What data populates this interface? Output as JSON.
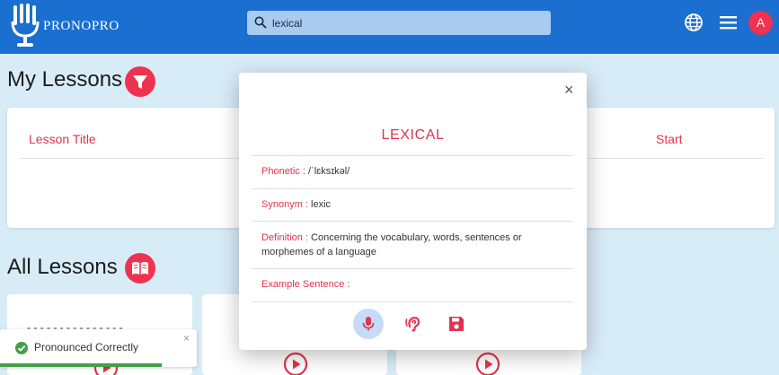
{
  "app": {
    "brand": "PRONOPRO",
    "brand_color": "#1a6fd0",
    "accent_color": "#e2334e"
  },
  "header": {
    "logo_icon": "microphone-hand-logo-icon",
    "search": {
      "icon": "search-icon",
      "value": "lexical"
    },
    "actions": {
      "language_icon": "globe-icon",
      "menu_icon": "hamburger-menu-icon",
      "avatar_letter": "A"
    }
  },
  "my_lessons": {
    "title": "My Lessons",
    "badge_icon": "filter-icon",
    "columns": [
      "Lesson Title",
      "Start"
    ]
  },
  "all_lessons": {
    "title": "All Lessons",
    "badge_icon": "open-book-icon",
    "cards": [
      {
        "partial_text": "- - - -   - - - - -   - -   - - - -",
        "play_icon": "play-circle-icon"
      },
      {
        "partial_text": "",
        "play_icon": "play-circle-icon"
      },
      {
        "partial_text": "",
        "play_icon": "play-circle-icon"
      }
    ]
  },
  "toast": {
    "icon": "check-circle-icon",
    "message": "Pronounced Correctly",
    "close": "×"
  },
  "word_modal": {
    "close": "×",
    "word": "LEXICAL",
    "fields": {
      "phonetic_label": "Phonetic :",
      "phonetic_value": "/ˈlɛksɪkəl/",
      "synonym_label": "Synonym :",
      "synonym_value": "lexic",
      "definition_label": "Definition :",
      "definition_value": "Concerning the vocabulary, words, sentences or morphemes of a language",
      "example_label": "Example Sentence :",
      "example_value": ""
    },
    "actions": {
      "record_icon": "microphone-icon",
      "listen_icon": "ear-listen-icon",
      "save_icon": "save-floppy-icon"
    }
  }
}
